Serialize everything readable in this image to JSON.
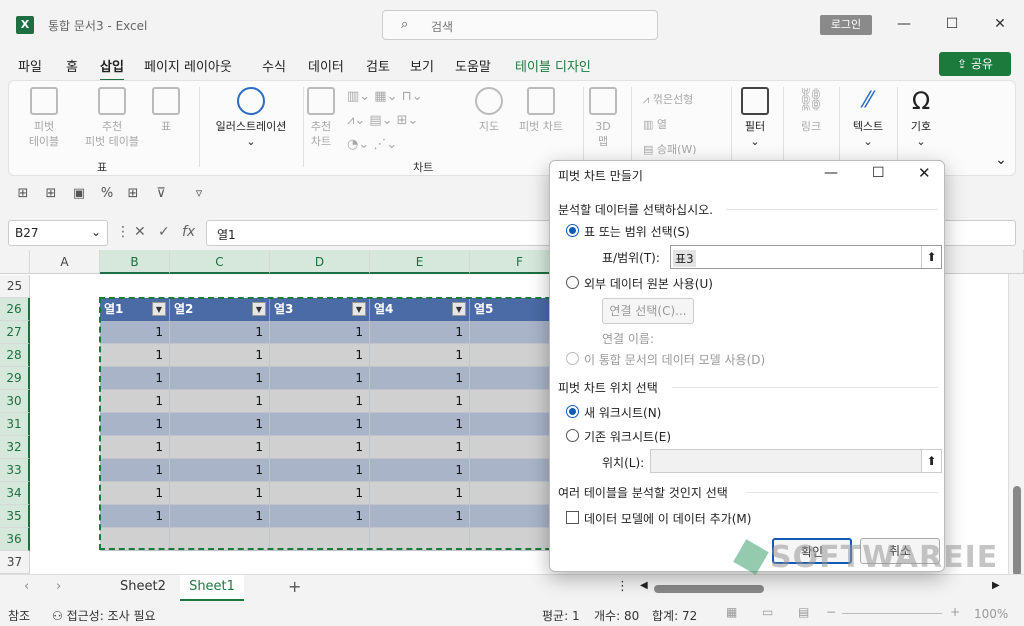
{
  "titlebar": {
    "app_logo": "X",
    "title": "통합 문서3  -  Excel",
    "search_placeholder": "검색",
    "login_label": "로그인",
    "min": "—",
    "max": "☐",
    "close": "✕"
  },
  "menu": {
    "items": [
      "파일",
      "홈",
      "삽입",
      "페이지 레이아웃",
      "수식",
      "데이터",
      "검토",
      "보기",
      "도움말",
      "테이블 디자인"
    ],
    "share": "공유"
  },
  "ribbon": {
    "pivot": "피벗\n테이블",
    "rec_pivot": "추천\n피벗 테이블",
    "table": "표",
    "group_table": "표",
    "illustration": "일러스트레이션",
    "rec_chart": "추천\n차트",
    "map": "지도",
    "pivot_chart": "피벗 차트",
    "chart3d": "3D\n맵",
    "sparkline_line": "꺾은선형",
    "sparkline_col": "열",
    "sparkline_wl": "승패(W)",
    "group_chart": "차트",
    "filter": "필터",
    "link": "링크",
    "text": "텍스트",
    "symbol": "기호"
  },
  "formula": {
    "namebox": "B27",
    "value": "열1"
  },
  "grid": {
    "col_headers": [
      "A",
      "B",
      "C",
      "D",
      "E",
      "F"
    ],
    "row_headers": [
      "25",
      "26",
      "27",
      "28",
      "29",
      "30",
      "31",
      "32",
      "33",
      "34",
      "35",
      "36",
      "37"
    ],
    "table_headers": [
      "열1",
      "열2",
      "열3",
      "열4",
      "열5"
    ],
    "cell_value": "1"
  },
  "sheets": {
    "tabs": [
      "Sheet2",
      "Sheet1"
    ],
    "active": "Sheet1",
    "add": "+"
  },
  "status": {
    "mode": "참조",
    "access": "접근성: 조사 필요",
    "avg": "평균: 1",
    "count": "개수: 80",
    "sum": "합계: 72",
    "zoom": "100%"
  },
  "dialog": {
    "title": "피벗 차트 만들기",
    "section1": "분석할 데이터를 선택하십시오.",
    "opt_range": "표 또는 범위 선택(S)",
    "range_label": "표/범위(T):",
    "range_value": "표3",
    "opt_external": "외부 데이터 원본 사용(U)",
    "conn_btn": "연결 선택(C)...",
    "conn_name": "연결 이름:",
    "opt_model": "이 통합 문서의 데이터 모델 사용(D)",
    "section2": "피벗 차트 위치 선택",
    "opt_new": "새 워크시트(N)",
    "opt_existing": "기존 워크시트(E)",
    "loc_label": "위치(L):",
    "section3": "여러 테이블을 분석할 것인지 선택",
    "add_model": "데이터 모델에 이 데이터 추가(M)",
    "ok": "확인",
    "cancel": "취소"
  },
  "watermark": "SOFTWAREIE"
}
